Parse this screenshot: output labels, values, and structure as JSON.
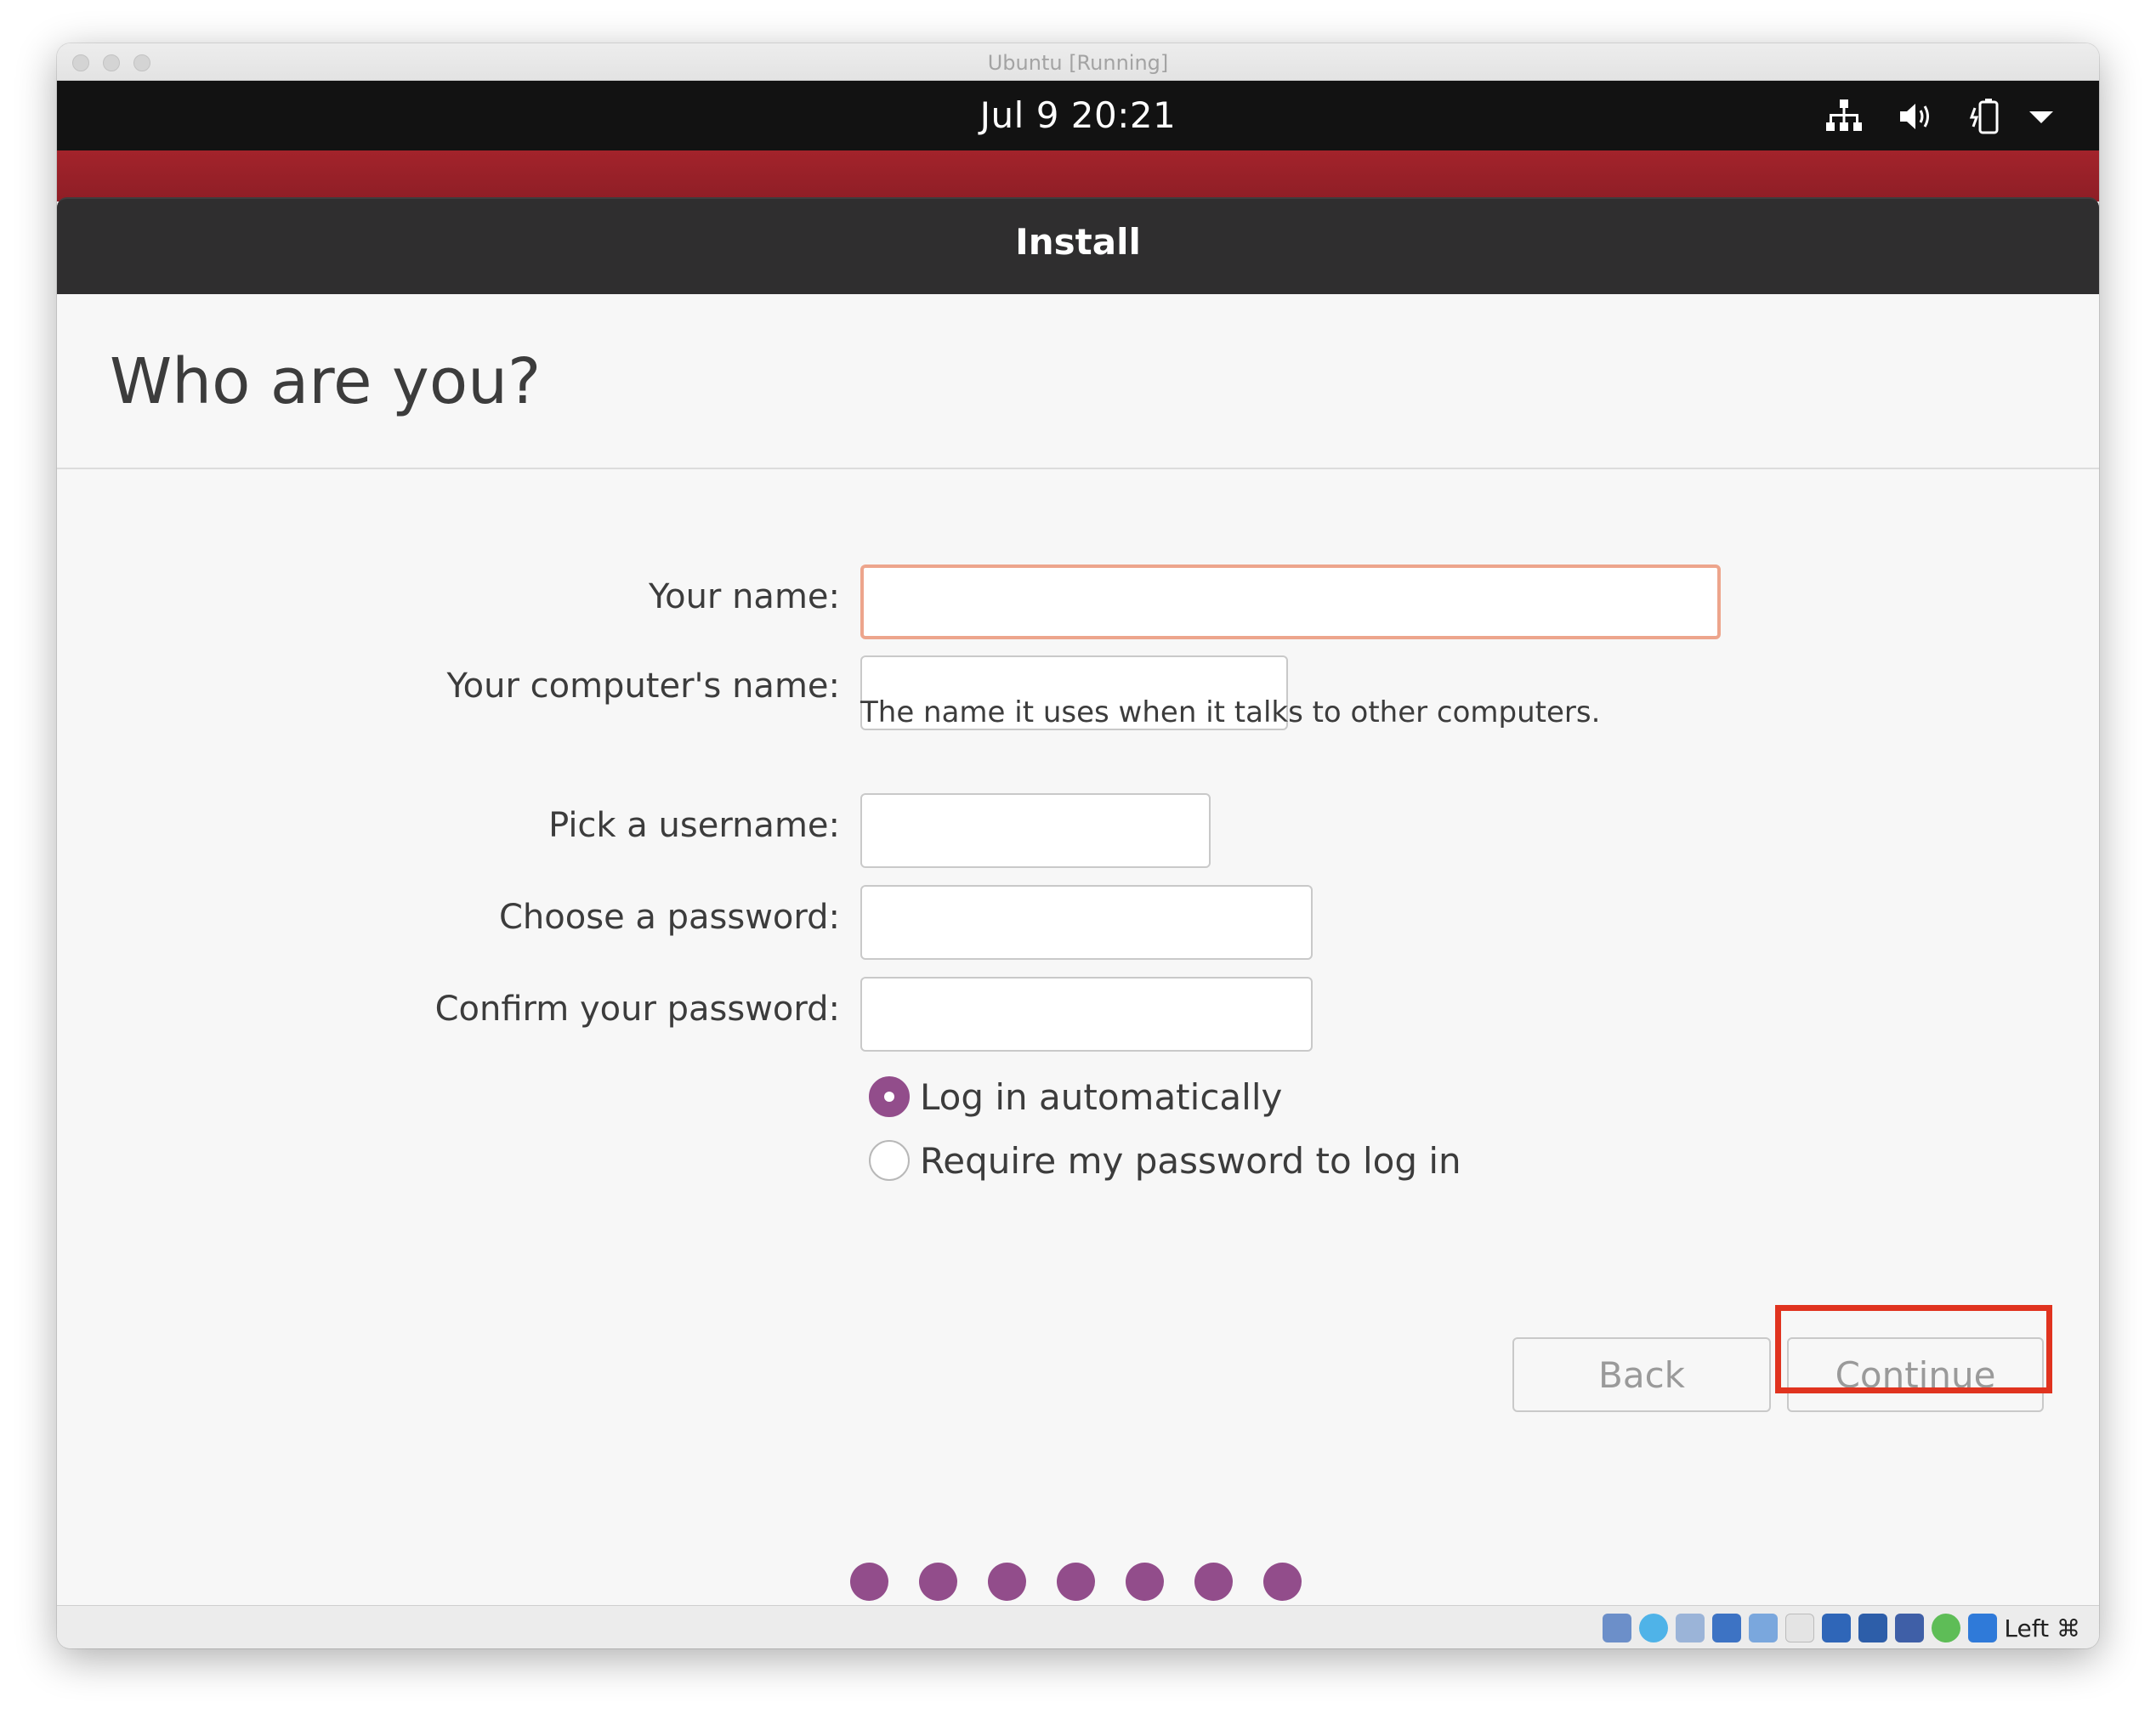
{
  "mac_window": {
    "title": "Ubuntu [Running]"
  },
  "top_bar": {
    "datetime": "Jul 9  20:21"
  },
  "installer": {
    "header_title": "Install",
    "page_title": "Who are you?",
    "fields": {
      "your_name": {
        "label": "Your name:",
        "value": ""
      },
      "computer_name": {
        "label": "Your computer's name:",
        "value": "",
        "hint": "The name it uses when it talks to other computers."
      },
      "username": {
        "label": "Pick a username:",
        "value": ""
      },
      "password": {
        "label": "Choose a password:",
        "value": ""
      },
      "confirm_password": {
        "label": "Confirm your password:",
        "value": ""
      }
    },
    "login_options": [
      {
        "label": "Log in automatically",
        "selected": true
      },
      {
        "label": "Require my password to log in",
        "selected": false
      }
    ],
    "buttons": {
      "back": "Back",
      "continue": "Continue"
    },
    "progress": {
      "total_steps": 7
    }
  },
  "vbox_status": {
    "host_key": "Left ⌘"
  },
  "colors": {
    "accent_purple": "#924d8b",
    "ubuntu_red": "#a3232b",
    "focus_border": "#eda58c",
    "highlight_red": "#e0331f"
  }
}
